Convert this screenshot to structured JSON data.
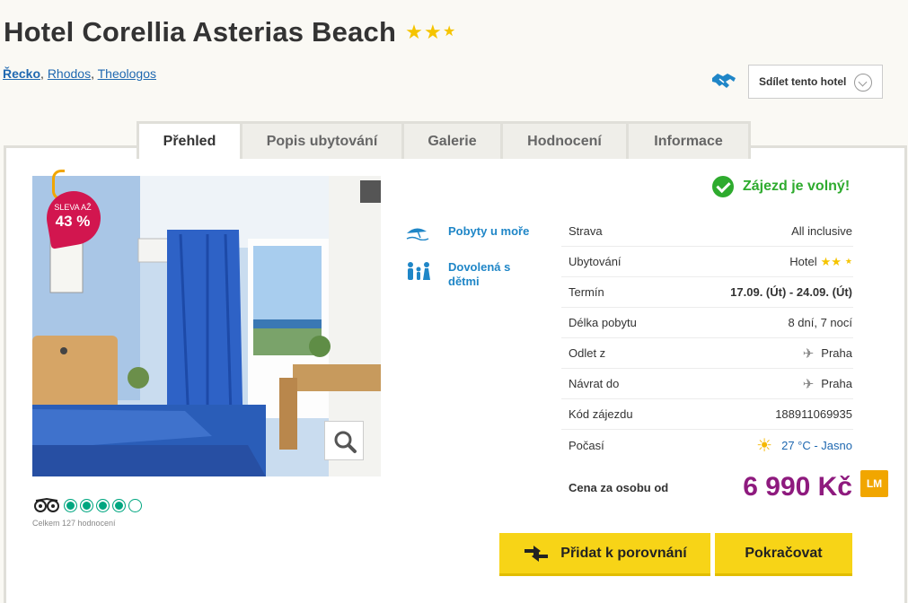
{
  "hotel": {
    "name": "Hotel Corellia Asterias Beach",
    "stars_full": 2,
    "stars_half": 1
  },
  "breadcrumb": [
    "Řecko",
    "Rhodos",
    "Theologos"
  ],
  "share_label": "Sdílet tento hotel",
  "tabs": [
    {
      "label": "Přehled",
      "active": true
    },
    {
      "label": "Popis ubytování",
      "active": false
    },
    {
      "label": "Galerie",
      "active": false
    },
    {
      "label": "Hodnocení",
      "active": false
    },
    {
      "label": "Informace",
      "active": false
    }
  ],
  "discount": {
    "line1": "SLEVA AŽ",
    "line2": "43 %"
  },
  "tripadvisor": {
    "rating_circles": 4,
    "count_label": "Celkem 127 hodnocení"
  },
  "tags": [
    "Pobyty u moře",
    "Dovolená s dětmi"
  ],
  "availability": "Zájezd je volný!",
  "details": [
    {
      "label": "Strava",
      "value": "All inclusive"
    },
    {
      "label": "Ubytování",
      "value": "Hotel"
    },
    {
      "label": "Termín",
      "value": "17.09. (Út) - 24.09. (Út)"
    },
    {
      "label": "Délka pobytu",
      "value": "8 dní, 7 nocí"
    },
    {
      "label": "Odlet z",
      "value": "Praha"
    },
    {
      "label": "Návrat do",
      "value": "Praha"
    },
    {
      "label": "Kód zájezdu",
      "value": "188911069935"
    },
    {
      "label": "Počasí",
      "value": "27 °C - Jasno"
    }
  ],
  "price": {
    "label": "Cena za osobu od",
    "value": "6 990 Kč",
    "badge": "LM"
  },
  "buttons": {
    "compare": "Přidat k porovnání",
    "continue": "Pokračovat"
  },
  "colors": {
    "accent_yellow": "#f7d417",
    "price_purple": "#8e1a7e",
    "link_blue": "#1f68b0",
    "success_green": "#2eab2e",
    "discount_red": "#d2164f"
  }
}
